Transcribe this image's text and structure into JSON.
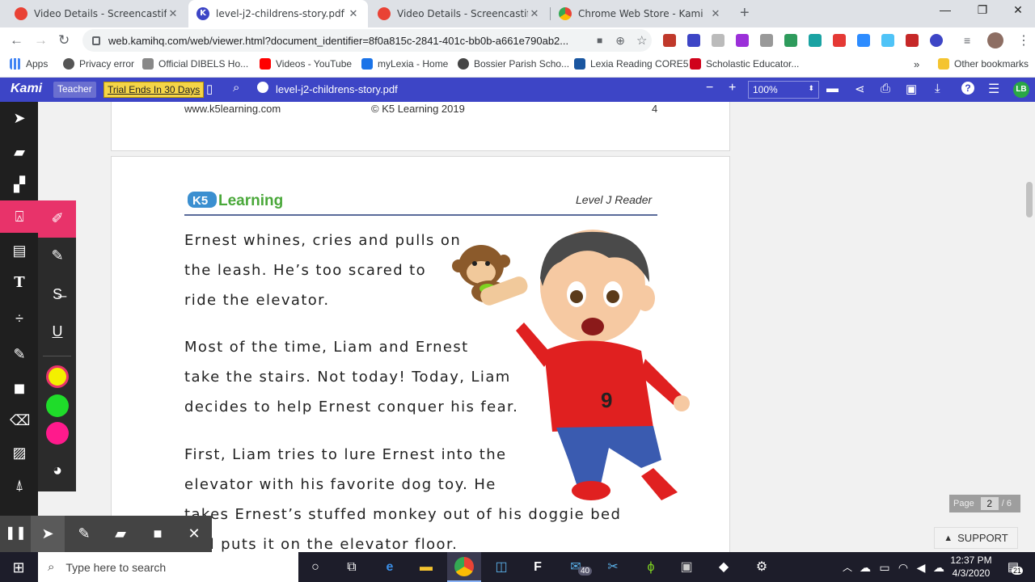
{
  "browser": {
    "tabs": [
      {
        "title": "Video Details - Screencastify",
        "favicon_color": "#e94235"
      },
      {
        "title": "level-j2-childrens-story.pdf",
        "favicon_color": "#3d45c6",
        "active": true
      },
      {
        "title": "Video Details - Screencastify",
        "favicon_color": "#e94235"
      },
      {
        "title": "Chrome Web Store - Kami",
        "favicon_color": "#fbbc04"
      }
    ],
    "url": "web.kamihq.com/web/viewer.html?document_identifier=8f0a815c-2841-401c-bb0b-a661e790ab2..."
  },
  "bookmarks": {
    "items": [
      {
        "label": "Apps",
        "icon_color": "#4285f4"
      },
      {
        "label": "Privacy error",
        "icon_color": "#555555"
      },
      {
        "label": "Official DIBELS Ho...",
        "icon_color": "#888888"
      },
      {
        "label": "Videos - YouTube",
        "icon_color": "#ff0000"
      },
      {
        "label": "myLexia - Home",
        "icon_color": "#1a73e8"
      },
      {
        "label": "Bossier Parish Scho...",
        "icon_color": "#444444"
      },
      {
        "label": "Lexia Reading CORE5",
        "icon_color": "#1a56a0"
      },
      {
        "label": "Scholastic Educator...",
        "icon_color": "#d0021b"
      }
    ],
    "more": "»",
    "other": "Other bookmarks"
  },
  "kami": {
    "logo": "Kami",
    "role": "Teacher",
    "trial": "Trial Ends In 30 Days",
    "filename": "level-j2-childrens-story.pdf",
    "zoom": "100%",
    "user_initials": "LB",
    "accent": "#3d45c6"
  },
  "document": {
    "page1_footer": {
      "site": "www.k5learning.com",
      "copyright": "© K5 Learning 2019",
      "page_number": "4"
    },
    "page2_header": {
      "logo_text": "K5 Learning",
      "level": "Level J Reader"
    },
    "paragraphs": [
      [
        "Ernest whines, cries and pulls on",
        "the leash. He’s too scared to",
        "ride the elevator."
      ],
      [
        "Most of the time, Liam and Ernest",
        "take the stairs. Not today! Today, Liam",
        "decides to help Ernest conquer his fear."
      ],
      [
        "First, Liam tries to lure Ernest into the",
        "elevator with his favorite dog toy. He",
        "takes Ernest’s stuffed monkey out of his doggie bed",
        "and puts it on the elevator floor."
      ]
    ],
    "shirt_number": "9"
  },
  "viewer": {
    "page_label": "Page",
    "current_page": "2",
    "total_pages": "/ 6",
    "support": "SUPPORT"
  },
  "palette": {
    "colors": [
      "#f4f000",
      "#1fdc2a",
      "#ff1a8c"
    ]
  },
  "taskbar": {
    "search_placeholder": "Type here to search",
    "mail_badge": "40",
    "time": "12:37 PM",
    "date": "4/3/2020",
    "notification_count": "21"
  }
}
